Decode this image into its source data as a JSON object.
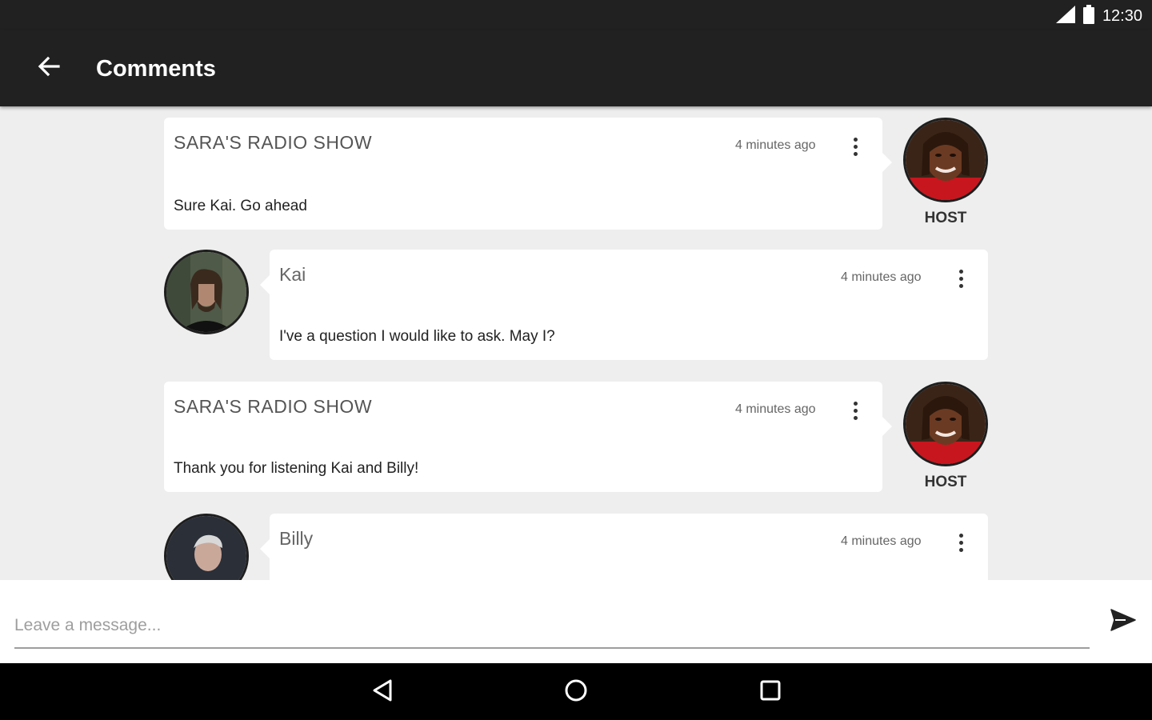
{
  "status_bar": {
    "time": "12:30"
  },
  "app_bar": {
    "title": "Comments"
  },
  "comments": [
    {
      "author": "SARA'S RADIO SHOW",
      "time": "4 minutes ago",
      "message": "Sure Kai. Go ahead",
      "role_label": "HOST"
    },
    {
      "author": "Kai",
      "time": "4 minutes ago",
      "message": "I've a question I would like to ask. May I?"
    },
    {
      "author": "SARA'S RADIO SHOW",
      "time": "4 minutes ago",
      "message": "Thank you for listening Kai and Billy!",
      "role_label": "HOST"
    },
    {
      "author": "Billy",
      "time": "4 minutes ago",
      "message": ""
    }
  ],
  "composer": {
    "placeholder": "Leave a message..."
  },
  "icons": {
    "back": "arrow-left-icon",
    "more": "more-vert-icon",
    "send": "send-icon",
    "nav_back": "triangle-back-icon",
    "nav_home": "circle-home-icon",
    "nav_recents": "square-recents-icon"
  },
  "colors": {
    "app_bar": "#212121",
    "background": "#eeeeee",
    "card": "#ffffff",
    "nav_bar": "#000000"
  }
}
